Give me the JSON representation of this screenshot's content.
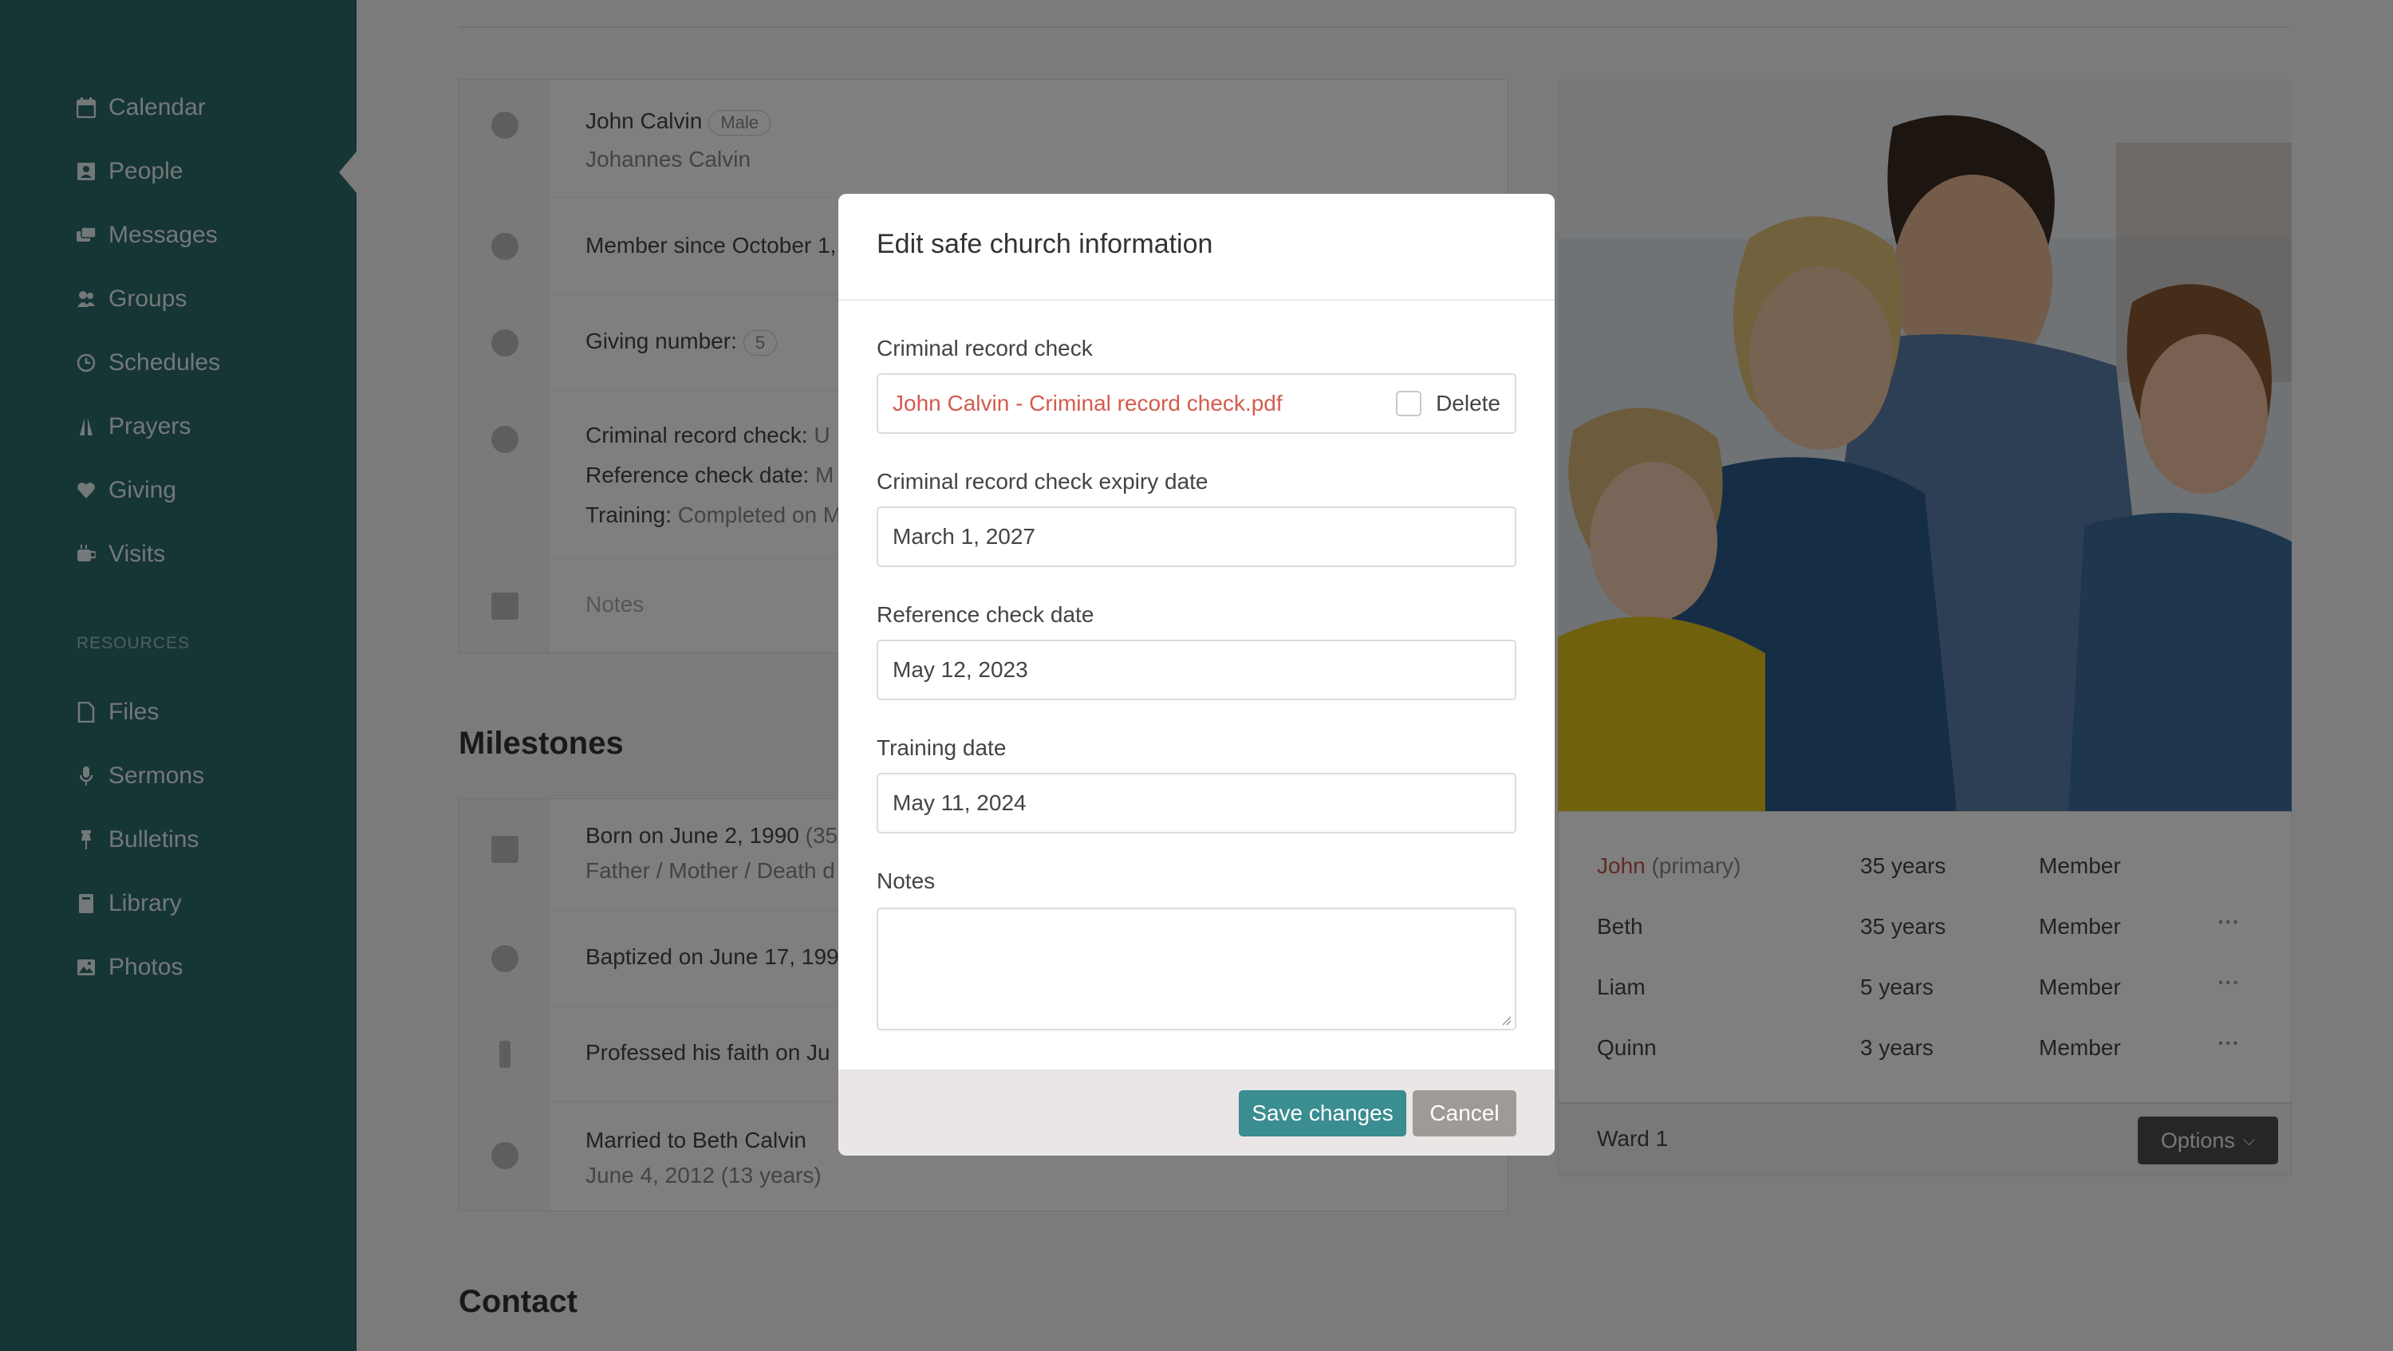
{
  "sidebar": {
    "items": [
      {
        "label": "Calendar",
        "icon": "calendar-icon"
      },
      {
        "label": "People",
        "icon": "people-icon"
      },
      {
        "label": "Messages",
        "icon": "messages-icon"
      },
      {
        "label": "Groups",
        "icon": "groups-icon"
      },
      {
        "label": "Schedules",
        "icon": "clock-icon"
      },
      {
        "label": "Prayers",
        "icon": "prayer-icon"
      },
      {
        "label": "Giving",
        "icon": "heart-icon"
      },
      {
        "label": "Visits",
        "icon": "coffee-icon"
      }
    ],
    "section_label": "RESOURCES",
    "resources": [
      {
        "label": "Files",
        "icon": "file-icon"
      },
      {
        "label": "Sermons",
        "icon": "microphone-icon"
      },
      {
        "label": "Bulletins",
        "icon": "pin-icon"
      },
      {
        "label": "Library",
        "icon": "book-icon"
      },
      {
        "label": "Photos",
        "icon": "image-icon"
      }
    ]
  },
  "profile": {
    "name": "John Calvin",
    "gender": "Male",
    "alt_name": "Johannes Calvin",
    "member_since": "Member since October 1,",
    "giving_label": "Giving number:",
    "giving_number": "5",
    "crc_label": "Criminal record check:",
    "crc_value": "U",
    "ref_label": "Reference check date:",
    "ref_value": "M",
    "training_label": "Training:",
    "training_value": "Completed on M",
    "notes_label": "Notes"
  },
  "milestones": {
    "title": "Milestones",
    "born": "Born on June 2, 1990",
    "born_extra": "(35",
    "born_sub": "Father / Mother / Death d",
    "baptized": "Baptized on June 17, 199",
    "professed": "Professed his faith on Ju",
    "married": "Married to Beth Calvin",
    "married_sub": "June 4, 2012 (13 years)"
  },
  "contact_title": "Contact",
  "family": {
    "members": [
      {
        "name": "John",
        "note": "(primary)",
        "age": "35 years",
        "status": "Member"
      },
      {
        "name": "Beth",
        "note": "",
        "age": "35 years",
        "status": "Member"
      },
      {
        "name": "Liam",
        "note": "",
        "age": "5 years",
        "status": "Member"
      },
      {
        "name": "Quinn",
        "note": "",
        "age": "3 years",
        "status": "Member"
      }
    ],
    "more": "···",
    "ward": "Ward 1",
    "options_label": "Options"
  },
  "modal": {
    "title": "Edit safe church information",
    "crc_label": "Criminal record check",
    "crc_file": "John Calvin - Criminal record check.pdf",
    "delete_label": "Delete",
    "expiry_label": "Criminal record check expiry date",
    "expiry_value": "March 1, 2027",
    "reference_label": "Reference check date",
    "reference_value": "May 12, 2023",
    "training_label": "Training date",
    "training_value": "May 11, 2024",
    "notes_label": "Notes",
    "notes_value": "",
    "save_label": "Save changes",
    "cancel_label": "Cancel"
  },
  "colors": {
    "sidebar": "#2d6a6b",
    "accent": "#3a8d91",
    "link": "#d45b4f",
    "cancel": "#a09a97"
  }
}
